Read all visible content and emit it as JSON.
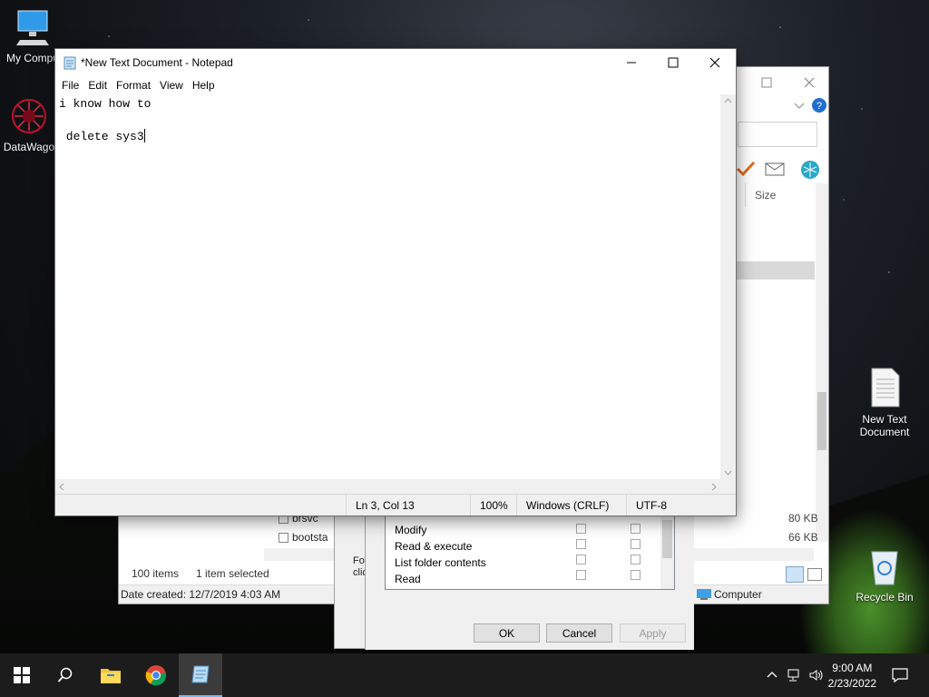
{
  "desktop": {
    "icons": [
      {
        "label": "My Compu",
        "icon": "monitor-icon"
      },
      {
        "label": "DataWago",
        "icon": "datawagon-icon"
      },
      {
        "label": "New Text Document",
        "icon": "text-file-icon"
      },
      {
        "label": "Recycle Bin",
        "icon": "recycle-bin-icon"
      }
    ]
  },
  "notepad": {
    "title": "*New Text Document - Notepad",
    "menu": [
      "File",
      "Edit",
      "Format",
      "View",
      "Help"
    ],
    "lines": [
      "i know how to",
      "",
      " delete sys3"
    ],
    "status": {
      "position": "Ln 3, Col 13",
      "zoom": "100%",
      "line_ending": "Windows (CRLF)",
      "encoding": "UTF-8"
    }
  },
  "explorer": {
    "column_size": "Size",
    "files": [
      {
        "name": "brsvc",
        "size": "80 KB"
      },
      {
        "name": "bootsta",
        "size": "66 KB"
      }
    ],
    "status_items": "100 items",
    "status_selected": "1 item selected",
    "details": "Date created: 12/7/2019 4:03 AM",
    "location": "Computer"
  },
  "permissions": {
    "note": "For",
    "note2": "clic",
    "rows": [
      "Modify",
      "Read & execute",
      "List folder contents",
      "Read"
    ],
    "ok": "OK",
    "cancel": "Cancel",
    "apply": "Apply"
  },
  "taskbar": {
    "time": "9:00 AM",
    "date": "2/23/2022"
  }
}
